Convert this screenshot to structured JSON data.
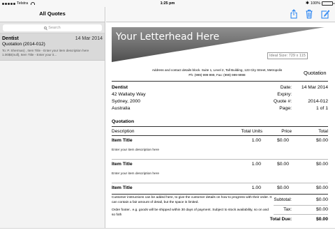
{
  "status": {
    "carrier": "Telstra",
    "time": "1:25 pm",
    "battery": "100%"
  },
  "sidebar": {
    "title": "All Quotes",
    "search_placeholder": "Search",
    "items": [
      {
        "title": "Dentist",
        "date": "14 Mar 2014",
        "subtitle": "Quotation (2014-012)",
        "description": "To: P. Sherman} , Item Title - Enter your item description here 1.00$0(null), Item Title - Enter your it..."
      }
    ]
  },
  "toolbar": {
    "share_icon": "share-icon",
    "trash_icon": "trash-icon",
    "compose_icon": "compose-icon"
  },
  "document": {
    "letterhead_title": "Your Letterhead Here",
    "ideal_size": "Ideal Size: 729 x 115",
    "address_line1": "Address and contact details block. Suite 1, Level 2, Tall Building, 123 City Street, Metropolis",
    "address_line2": "Ph: (999) 999-999, Fax: (999) 999-9998",
    "doc_type": "Quotation",
    "client": {
      "name": "Dentist",
      "line1": "42 Wallaby Way",
      "line2": "Sydney, 2000",
      "line3": "Australia"
    },
    "meta": {
      "date_label": "Date:",
      "date_value": "14 Mar 2014",
      "expiry_label": "Expiry:",
      "expiry_value": "",
      "quote_label": "Quote #:",
      "quote_value": "2014-012",
      "page_label": "Page:",
      "page_value": "1 of 1"
    },
    "section_title": "Quotation",
    "columns": {
      "description": "Description",
      "units": "Total Units",
      "price": "Price",
      "total": "Total"
    },
    "items": [
      {
        "title": "Item Title",
        "description": "Enter your item description here",
        "units": "1.00",
        "price": "$0.00",
        "total": "$0.00"
      },
      {
        "title": "Item Title",
        "description": "Enter your item description here",
        "units": "1.00",
        "price": "$0.00",
        "total": "$0.00"
      },
      {
        "title": "Item Title",
        "description": "",
        "units": "1.00",
        "price": "$0.00",
        "total": "$0.00"
      }
    ],
    "customer_instructions": "Customer instructions can be added here, to give the customer details on how to progress with their order. It can contain a fair amount of detail, but the space is limited.",
    "order_footer": "Order footer.. e.g. goods will be shipped within 30 days of payment. Subject to stock availability, so on and so foth",
    "totals": {
      "subtotal_label": "Subtotal:",
      "subtotal_value": "$0.00",
      "tax_label": "Tax:",
      "tax_value": "$0.00",
      "total_label": "Total Due:",
      "total_value": "$0.00"
    }
  }
}
